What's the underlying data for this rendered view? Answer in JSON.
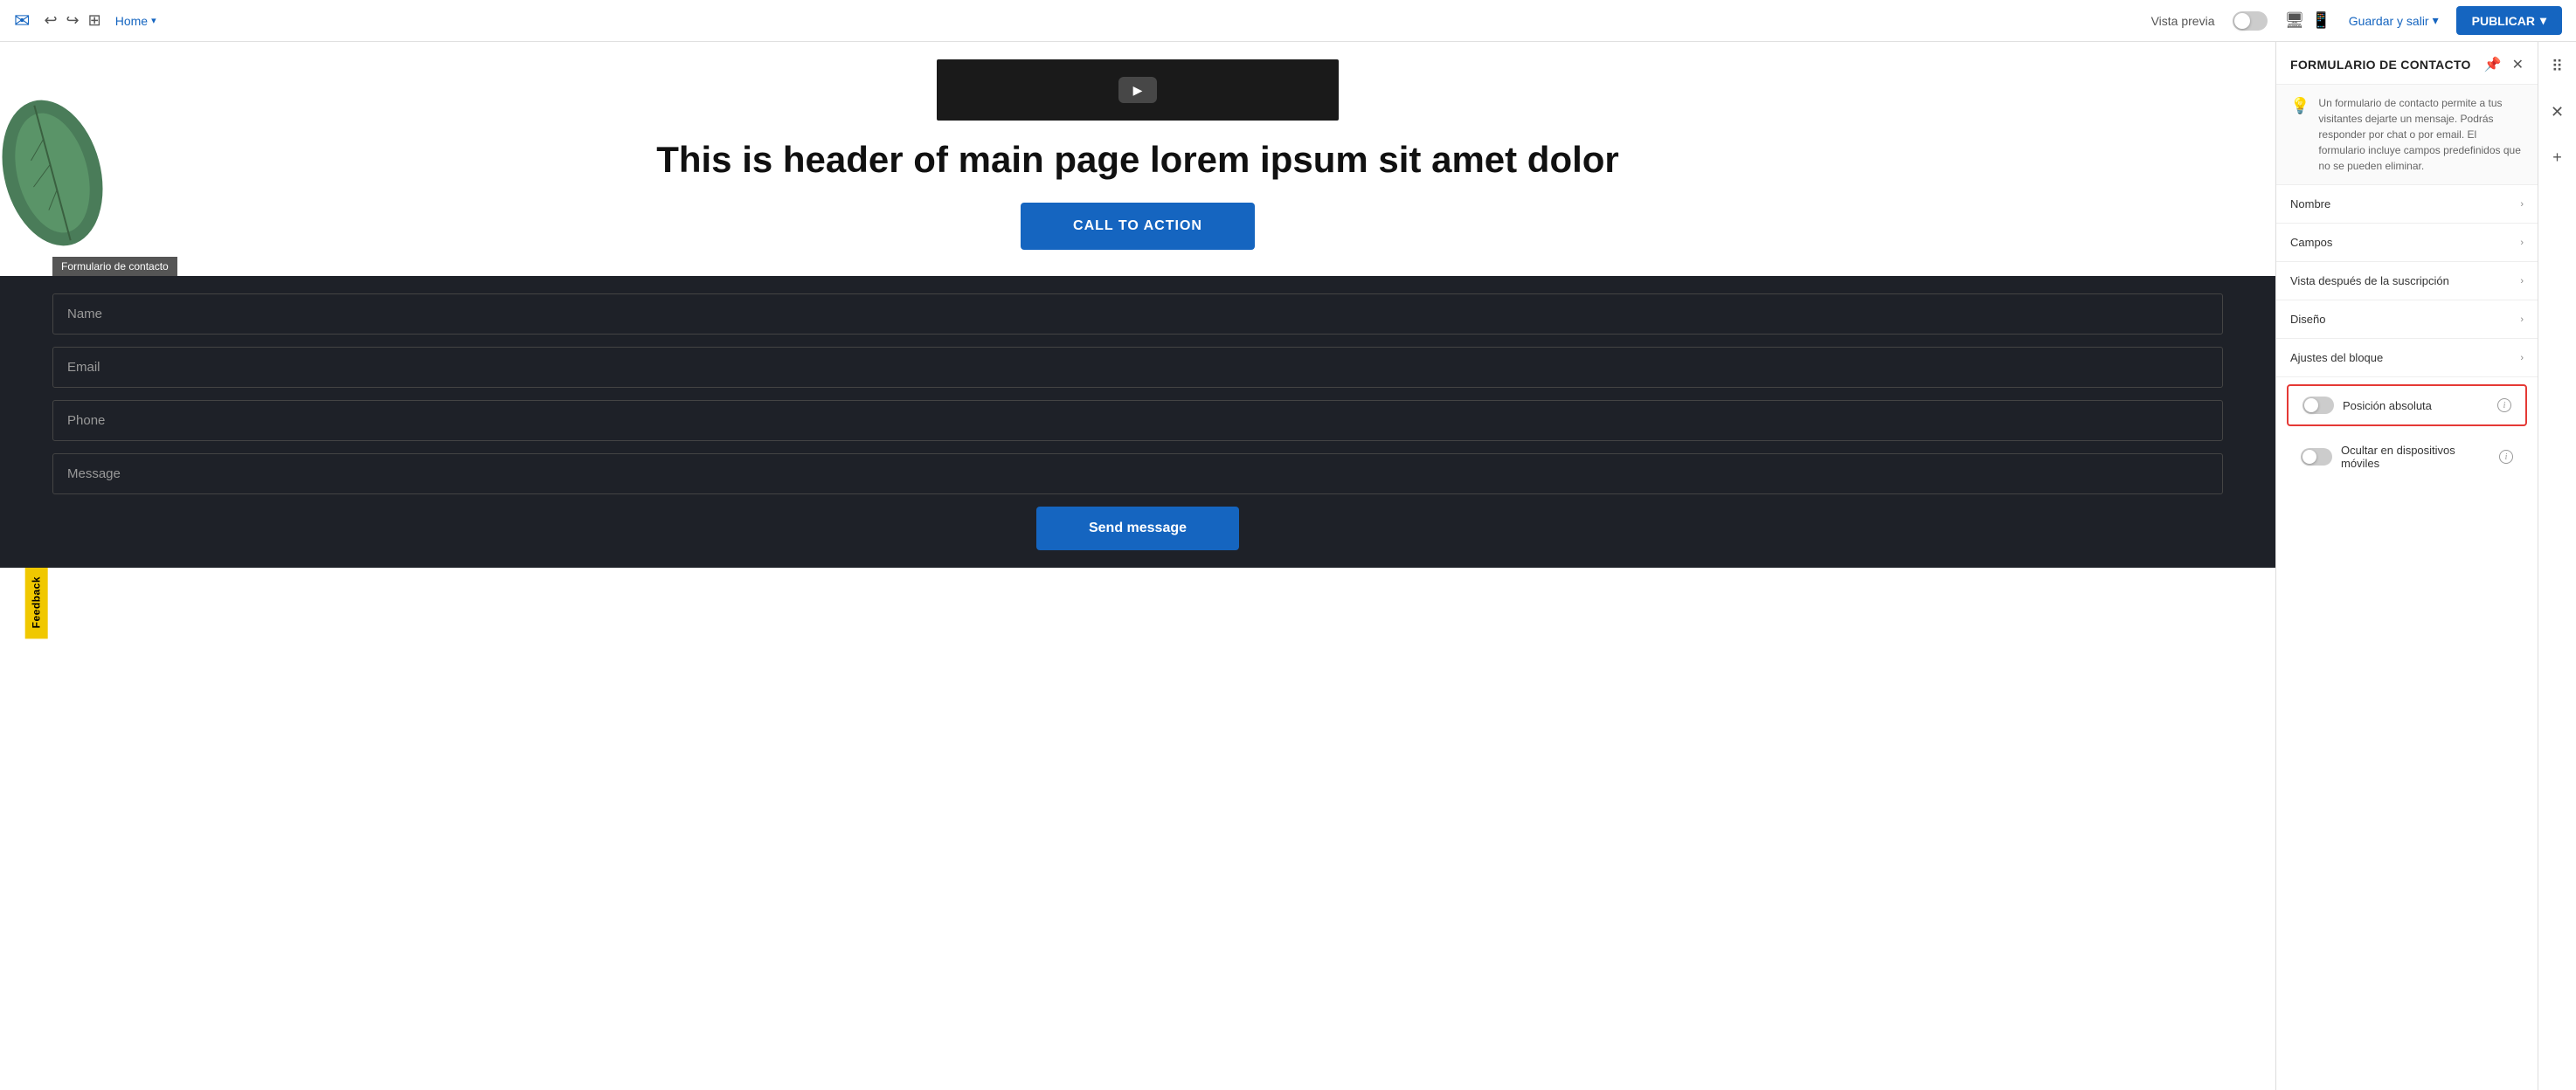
{
  "topbar": {
    "logo_icon": "✉",
    "home_label": "Home",
    "chevron": "▾",
    "vista_previa": "Vista previa",
    "guardar_label": "Guardar y salir",
    "guardar_chevron": "▾",
    "publicar_label": "PUBLICAR",
    "publicar_chevron": "▾"
  },
  "page": {
    "heading": "This is header of main page lorem ipsum sit amet dolor",
    "cta_label": "CALL TO ACTION",
    "feedback_label": "Feedback",
    "form": {
      "tag_label": "Formulario de contacto",
      "field_name": "Name",
      "field_email": "Email",
      "field_phone": "Phone",
      "field_message": "Message",
      "send_label": "Send message"
    }
  },
  "panel": {
    "title": "FORMULARIO DE CONTACTO",
    "close_icon": "✕",
    "pin_icon": "📌",
    "info_text": "Un formulario de contacto permite a tus visitantes dejarte un mensaje. Podrás responder por chat o por email. El formulario incluye campos predefinidos que no se pueden eliminar.",
    "accordion": [
      {
        "label": "Nombre"
      },
      {
        "label": "Campos"
      },
      {
        "label": "Vista después de la suscripción"
      },
      {
        "label": "Diseño"
      },
      {
        "label": "Ajustes del bloque"
      }
    ],
    "posicion_absoluta_label": "Posición absoluta",
    "ocultar_label": "Ocultar en dispositivos móviles"
  },
  "right_sidebar": {
    "layers_icon": "⠿",
    "close_icon": "✕",
    "add_icon": "+"
  }
}
